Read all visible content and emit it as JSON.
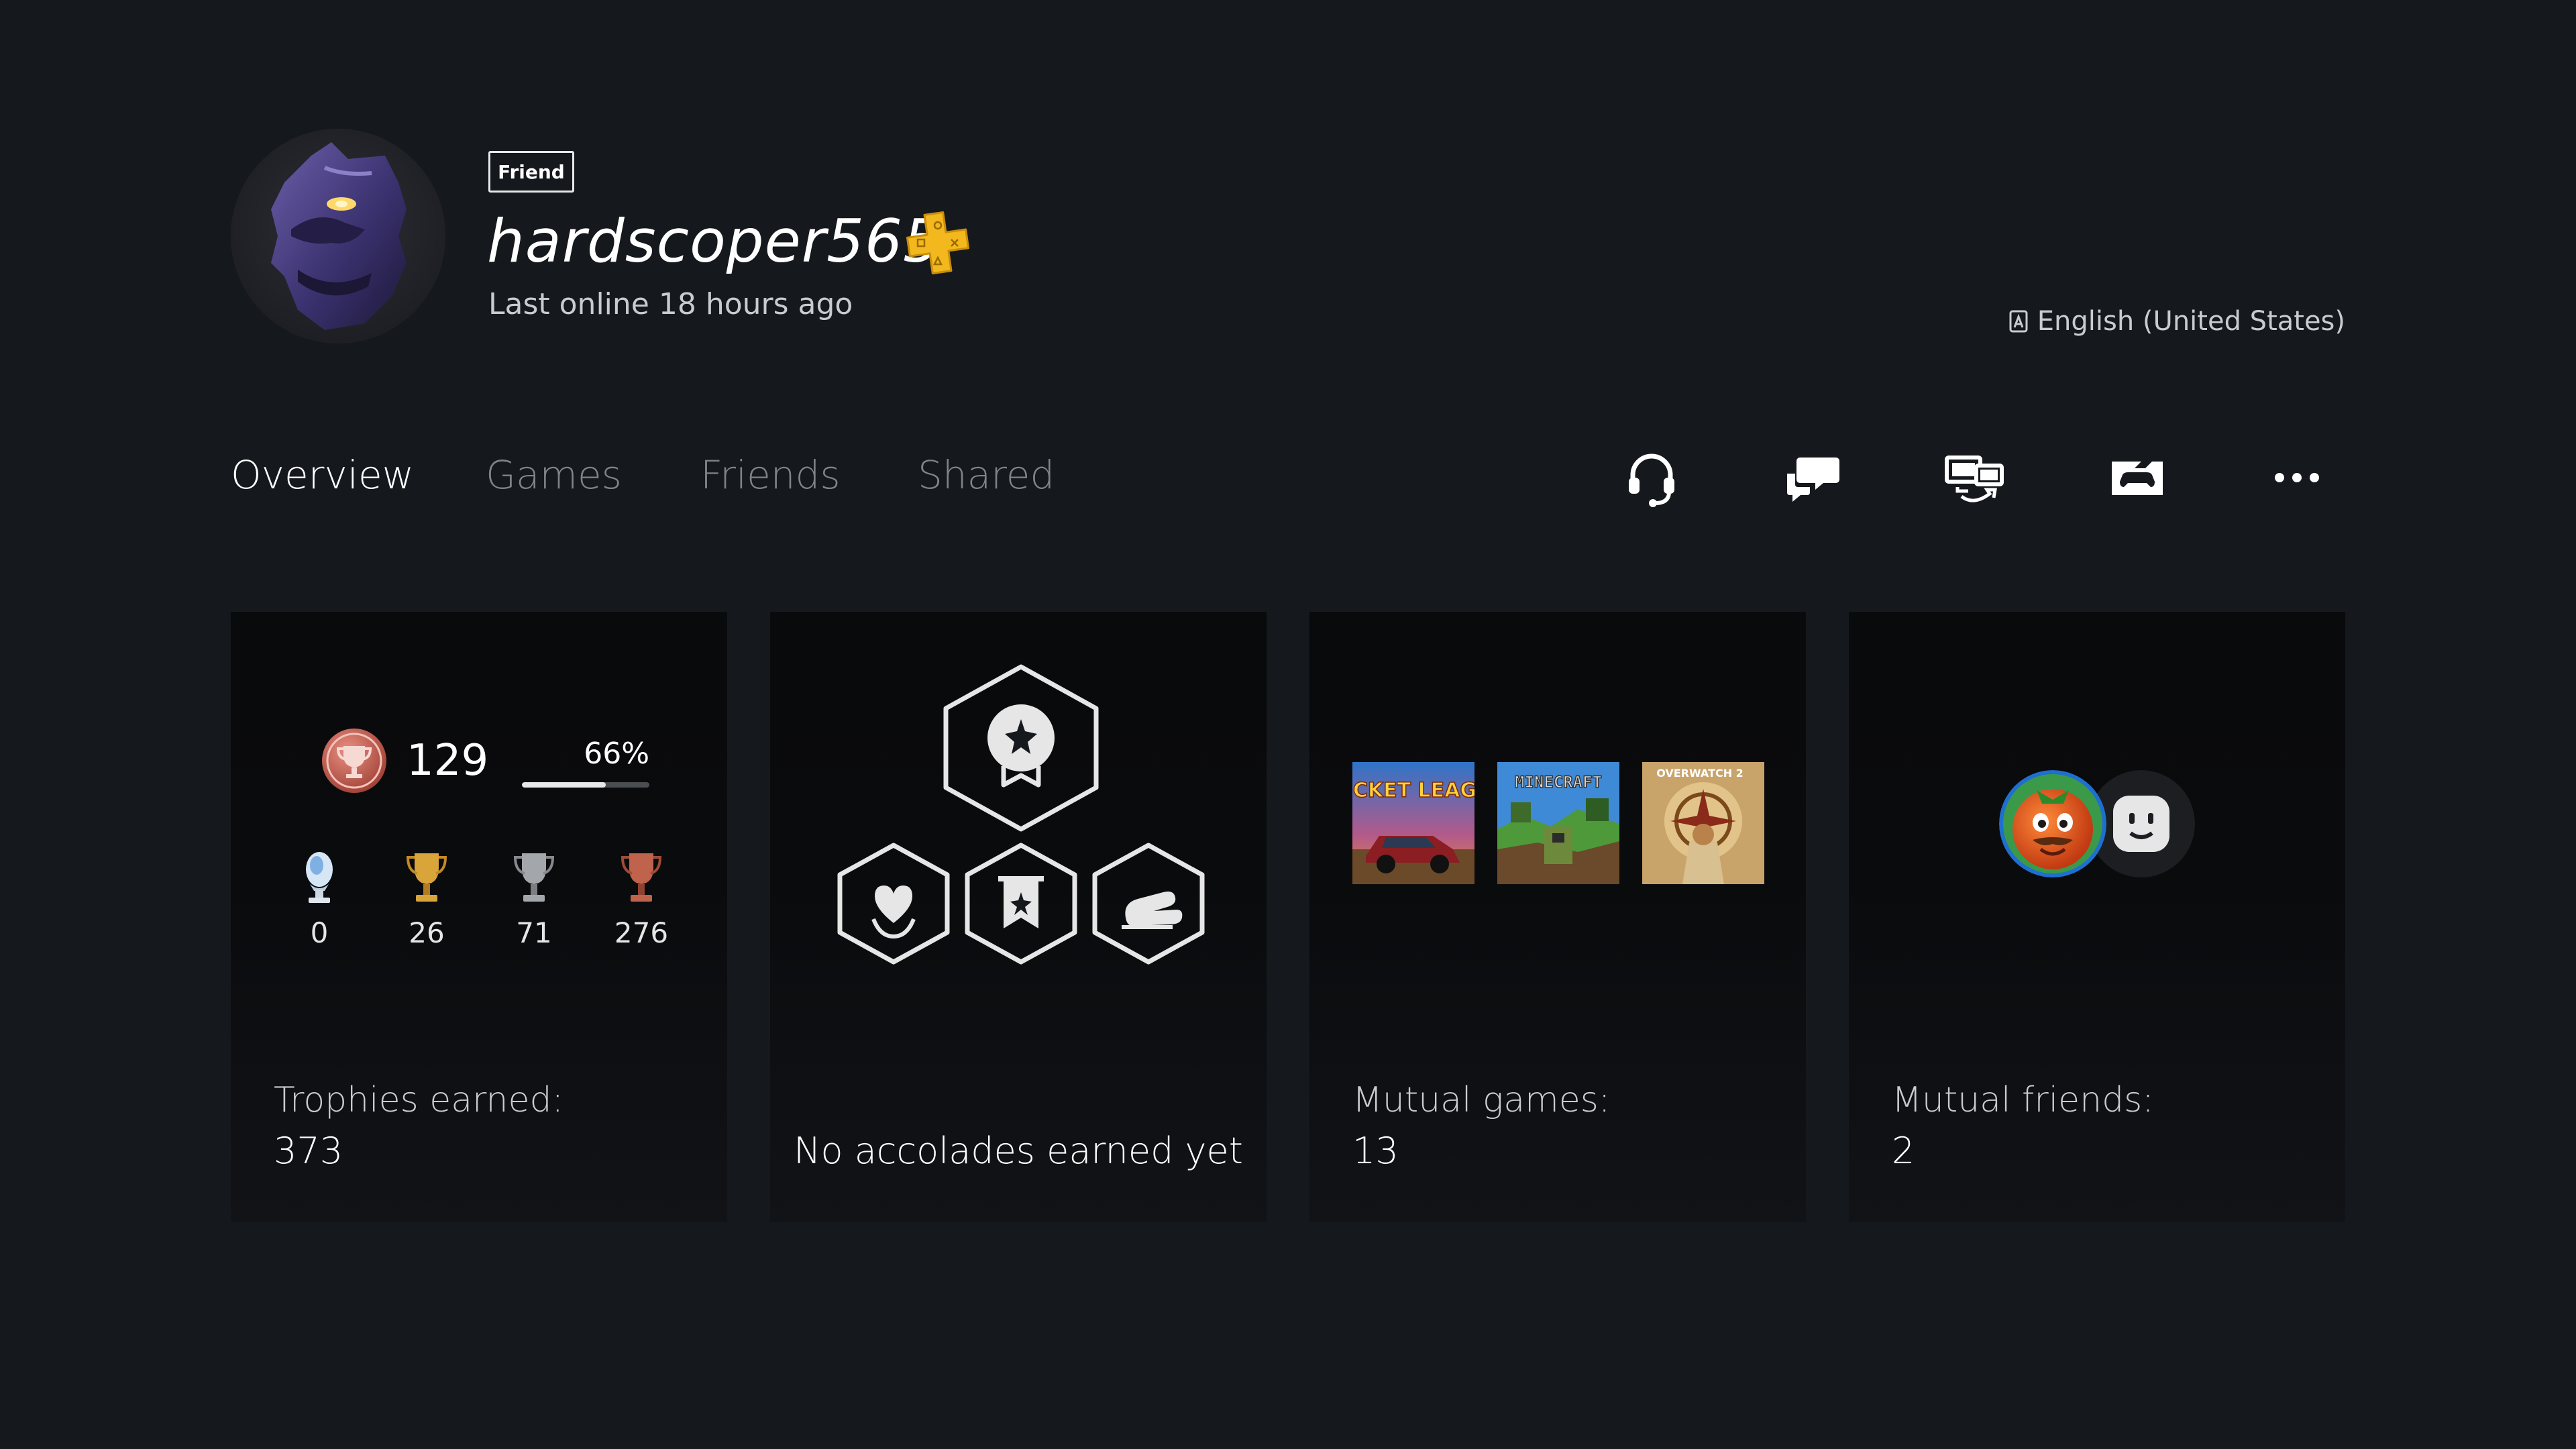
{
  "profile": {
    "relationship_badge": "Friend",
    "username": "hardscoper565",
    "last_online": "Last online 18 hours ago",
    "language": "English (United States)",
    "ps_plus_icon": "ps-plus-icon"
  },
  "tabs": [
    {
      "label": "Overview",
      "active": true
    },
    {
      "label": "Games",
      "active": false
    },
    {
      "label": "Friends",
      "active": false
    },
    {
      "label": "Shared",
      "active": false
    }
  ],
  "actions": [
    {
      "icon": "party-voice-icon"
    },
    {
      "icon": "message-icon"
    },
    {
      "icon": "share-screen-icon"
    },
    {
      "icon": "game-join-icon"
    },
    {
      "icon": "more-options-icon"
    }
  ],
  "trophies": {
    "level": "129",
    "progress_label": "66%",
    "progress": 0.66,
    "counts": [
      {
        "type": "platinum",
        "count": "0",
        "color": "#8fb3d9"
      },
      {
        "type": "gold",
        "count": "26",
        "color": "#c99a34"
      },
      {
        "type": "silver",
        "count": "71",
        "color": "#9a9da3"
      },
      {
        "type": "bronze",
        "count": "276",
        "color": "#b65a45"
      }
    ],
    "label": "Trophies earned:",
    "total": "373"
  },
  "accolades": {
    "text": "No accolades earned yet"
  },
  "mutual_games": {
    "label": "Mutual games:",
    "count": "13",
    "games": [
      {
        "title": "ROCKET LEAGUE"
      },
      {
        "title": "MINECRAFT"
      },
      {
        "title": "OVERWATCH 2"
      }
    ]
  },
  "mutual_friends": {
    "label": "Mutual friends:",
    "count": "2"
  },
  "colors": {
    "background": "#15181c",
    "card": "#0a0b0d",
    "ps_plus": "#f5c518",
    "inactive_tab": "#7f838a"
  }
}
